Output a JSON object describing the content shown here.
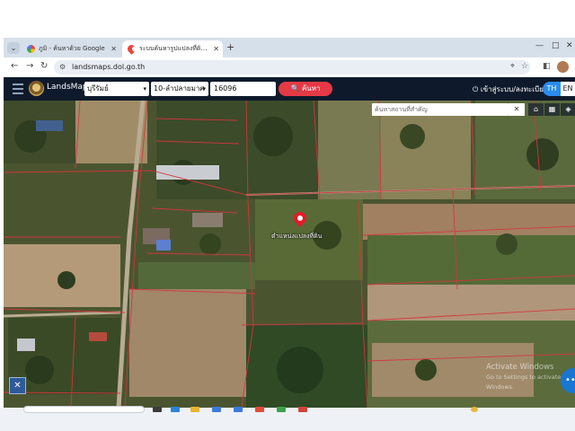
{
  "browser": {
    "tabs": [
      {
        "title": "ภูมิ - ค้นหาด้วย Google",
        "active": false,
        "favicon": "google-icon"
      },
      {
        "title": "ระบบค้นหารูปแปลงที่ดิน (LandsMaps)",
        "active": true,
        "favicon": "map-pin-icon"
      }
    ],
    "new_tab": "+",
    "window_controls": [
      "—",
      "□",
      "✕"
    ],
    "url": "landsmaps.dol.go.th"
  },
  "app": {
    "brand": "LandsMaps",
    "province": "บุรีรัมย์",
    "district": "10-ลำปลายมาศ",
    "parcel_number": "16096",
    "search_button": "ค้นหา",
    "login": "เข้าสู่ระบบ/ลงทะเบียน",
    "lang": {
      "th": "TH",
      "en": "EN",
      "active": "TH"
    }
  },
  "map": {
    "place_search_placeholder": "ค้นหาสถานที่สำคัญ",
    "pin_label": "ตำแหน่งแปลงที่ดิน",
    "tools": [
      "home-icon",
      "grid-icon",
      "layers-icon"
    ],
    "parcel_line_color": "#d8343f",
    "watermark": {
      "title": "Activate Windows",
      "subtitle": "Go to Settings to activate Windows."
    }
  },
  "colors": {
    "header": "#0e1a2b",
    "search_button": "#e53945",
    "lang_active": "#2a8cf0",
    "pin": "#e31b2a"
  }
}
